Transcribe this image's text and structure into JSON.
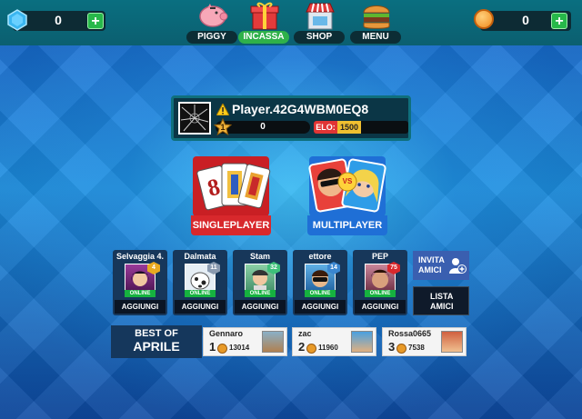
{
  "topbar": {
    "gems": "0",
    "coins": "0",
    "add_gems_label": "+",
    "add_coins_label": "+",
    "nav": [
      {
        "label": "PIGGY",
        "icon": "piggy-bank-icon"
      },
      {
        "label": "INCASSA",
        "icon": "gift-icon"
      },
      {
        "label": "SHOP",
        "icon": "shop-icon"
      },
      {
        "label": "MENU",
        "icon": "burger-menu-icon"
      }
    ]
  },
  "player": {
    "name": "Player.42G4WBM0EQ8",
    "level": "1",
    "xp": "0",
    "elo_label": "ELO:",
    "elo_value": "1500"
  },
  "modes": {
    "single": "SINGLEPLAYER",
    "multi": "MULTIPLAYER",
    "vs": "VS"
  },
  "friends": [
    {
      "name": "Selvaggia 4.",
      "level": "4",
      "status": "ONLINE",
      "action": "AGGIUNGI"
    },
    {
      "name": "Dalmata",
      "level": "11",
      "status": "ONLINE",
      "action": "AGGIUNGI"
    },
    {
      "name": "Stam",
      "level": "32",
      "status": "ONLINE",
      "action": "AGGIUNGI"
    },
    {
      "name": "ettore",
      "level": "14",
      "status": "ONLINE",
      "action": "AGGIUNGI"
    },
    {
      "name": "PEP",
      "level": "75",
      "status": "ONLINE",
      "action": "AGGIUNGI"
    }
  ],
  "side": {
    "invite_line1": "INVITA",
    "invite_line2": "AMICI",
    "list_line1": "LISTA",
    "list_line2": "AMICI"
  },
  "best": {
    "line1": "BEST OF",
    "line2": "APRILE",
    "ranking": [
      {
        "position": "1",
        "name": "Gennaro",
        "score": "13014"
      },
      {
        "position": "2",
        "name": "zac",
        "score": "11960"
      },
      {
        "position": "3",
        "name": "Rossa0665",
        "score": "7538"
      }
    ]
  },
  "colors": {
    "online": "#16b23f",
    "singleplayer": "#d8282c",
    "multiplayer": "#1f6fd6",
    "elo_red": "#e03535",
    "elo_gold": "#f0c030"
  }
}
